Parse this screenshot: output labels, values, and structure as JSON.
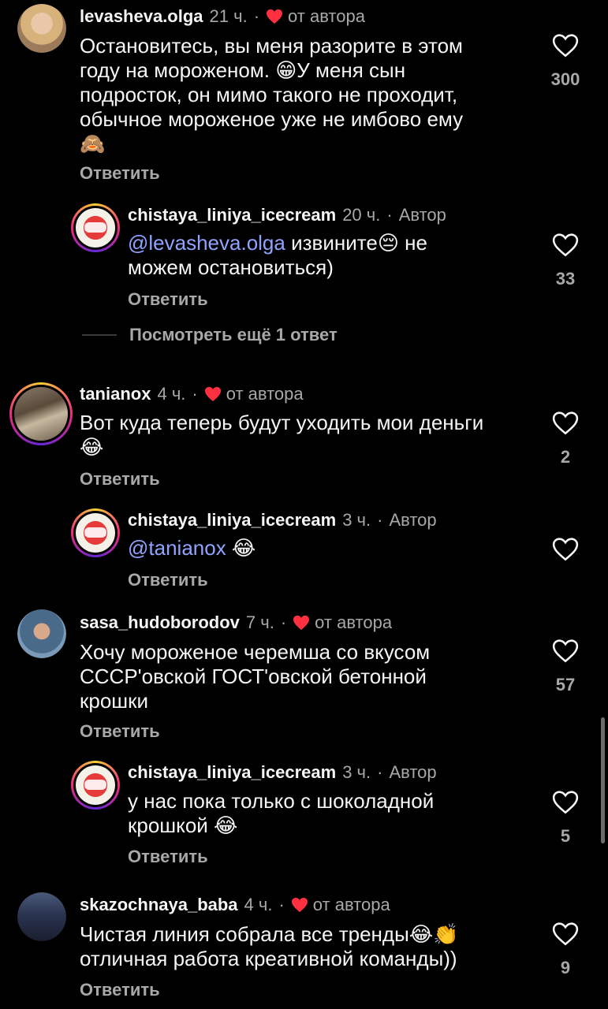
{
  "comments": [
    {
      "username": "levasheva.olga",
      "time": "21 ч.",
      "by_author": "от автора",
      "text": "Остановитесь, вы меня разорите в этом\nгоду на мороженом. 😁У меня сын\nподросток, он мимо такого не проходит,\nобычное мороженое уже не имбово ему\n🙈",
      "reply_label": "Ответить",
      "likes": "300"
    },
    {
      "username": "chistaya_liniya_icecream",
      "time": "20 ч.",
      "author_tag": "Автор",
      "mention": "@levasheva.olga",
      "text": " извините😔 не\nможем остановиться)",
      "reply_label": "Ответить",
      "likes": "33"
    },
    {
      "view_more": "Посмотреть ещё 1 ответ"
    },
    {
      "username": "tanianox",
      "time": "4 ч.",
      "by_author": "от автора",
      "text": "Вот куда теперь будут уходить мои деньги\n😂",
      "reply_label": "Ответить",
      "likes": "2"
    },
    {
      "username": "chistaya_liniya_icecream",
      "time": "3 ч.",
      "author_tag": "Автор",
      "mention": "@tanianox",
      "text": " 😂",
      "reply_label": "Ответить",
      "likes": ""
    },
    {
      "username": "sasa_hudoborodov",
      "time": "7 ч.",
      "by_author": "от автора",
      "text": "Хочу мороженое черемша со вкусом\nСССР'овской ГОСТ'овской бетонной\nкрошки",
      "reply_label": "Ответить",
      "likes": "57"
    },
    {
      "username": "chistaya_liniya_icecream",
      "time": "3 ч.",
      "author_tag": "Автор",
      "text": "у нас пока только с шоколадной\nкрошкой 😂",
      "reply_label": "Ответить",
      "likes": "5"
    },
    {
      "username": "skazochnaya_baba",
      "time": "4 ч.",
      "by_author": "от автора",
      "text": "Чистая линия собрала все тренды😂👏\nотличная работа креативной команды))",
      "reply_label": "Ответить",
      "likes": "9"
    }
  ],
  "separator": "·",
  "colors": {
    "background": "#000000",
    "heart_red": "#ff3040",
    "mention": "#8fa4ff",
    "secondary_text": "#a8a8a8"
  }
}
